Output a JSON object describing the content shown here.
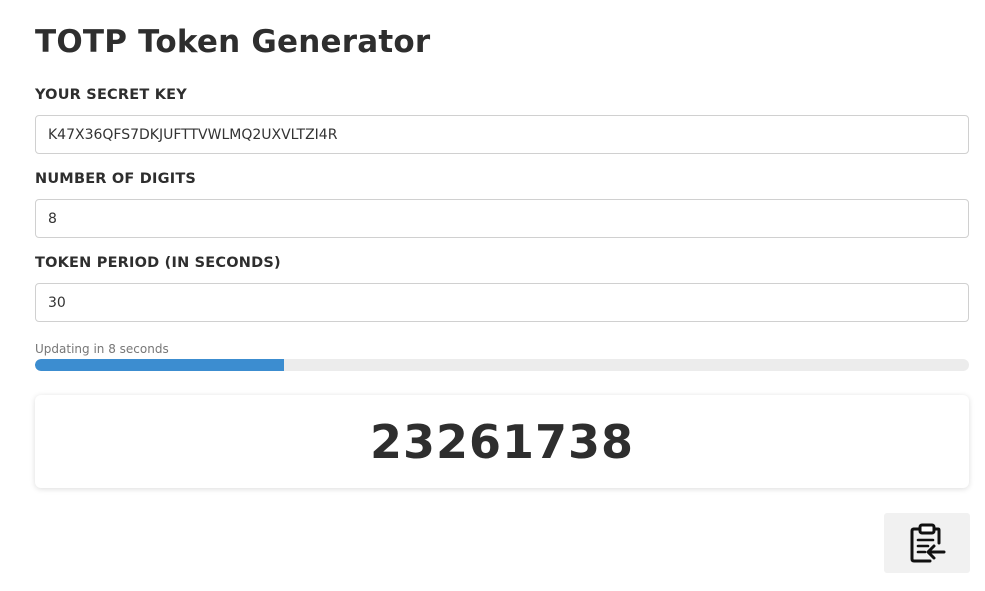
{
  "title": "TOTP Token Generator",
  "fields": [
    {
      "label": "YOUR SECRET KEY",
      "value": "K47X36QFS7DKJUFTTVWLMQ2UXVLTZI4R"
    },
    {
      "label": "NUMBER OF DIGITS",
      "value": "8"
    },
    {
      "label": "TOKEN PERIOD (IN SECONDS)",
      "value": "30"
    }
  ],
  "countdown": {
    "text": "Updating in 8 seconds",
    "progress_fraction": 0.267
  },
  "token": "23261738",
  "copy_button": {
    "icon": "clipboard-paste-icon"
  },
  "colors": {
    "progress_fill": "#3c8dd0",
    "progress_track": "#ececec"
  }
}
